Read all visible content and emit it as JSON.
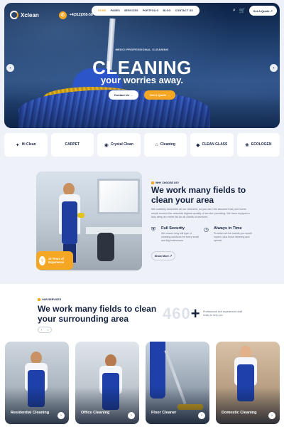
{
  "header": {
    "logo_text": "Xclean",
    "phone": "+4(312)055-58",
    "menu": [
      "HOME",
      "PAGES",
      "SERVICES",
      "PORTFOLIO",
      "BLOG",
      "CONTACT US"
    ],
    "active_menu": "HOME",
    "quote_label": "Get A Quote ↗"
  },
  "hero": {
    "eyebrow": "MEDCI PROFESSIONAL CLEANING",
    "title": "CLEANING",
    "subtitle": "your worries away.",
    "btn_contact": "Contact Us →",
    "btn_quote": "Get A Quote →"
  },
  "brands": [
    "Hi Clean",
    "CARPET",
    "Crystal Clean",
    "Cleaning",
    "CLEAN GLASS",
    "ECOLOGEN"
  ],
  "about": {
    "tag": "WHY CHOOSE US?",
    "heading": "We work many fields to clean your area",
    "paragraph": "We carefully assemble all our cleaners, so you can rest assured that your home would receive the absolute highest quality of service providing. We have enjoyed a fully deep an entire list for all clients of services.",
    "features": [
      {
        "title": "Full Security",
        "text": "We ensure long will type of cleaning solutions for every small and big businesses"
      },
      {
        "title": "Always in Time",
        "text": "Provides all the brands you would expect, plus those cleaning and special"
      }
    ],
    "show_more": "Show More ↗",
    "badge": "15 Years of Experience"
  },
  "services": {
    "tag": "OUR SERVICES",
    "heading": "We work many fields to clean your surrounding area",
    "counter": "460",
    "counter_suffix": "+",
    "description": "Professional and experienced staff ready to help you",
    "cards": [
      "Residential Cleaning",
      "Office Cleaning",
      "Floor Cleaner",
      "Domestic Cleaning"
    ]
  },
  "colors": {
    "accent": "#f5a623",
    "navy": "#13213f",
    "blue": "#1e40a8"
  }
}
